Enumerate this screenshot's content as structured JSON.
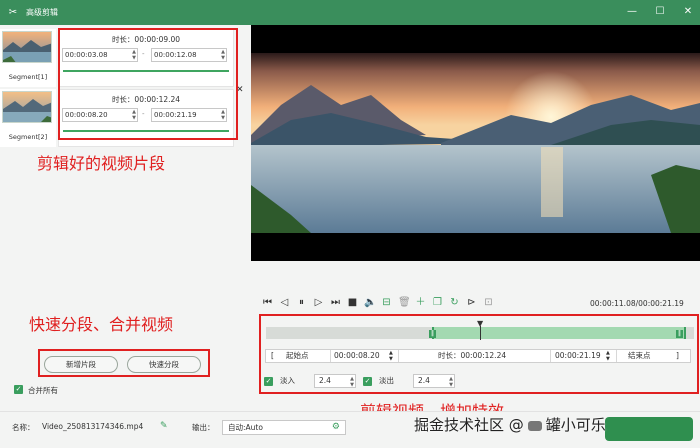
{
  "window": {
    "title": "高级剪辑",
    "minimize_icon": "minimize-icon",
    "maximize_icon": "maximize-icon",
    "close_icon": "close-icon"
  },
  "segments": [
    {
      "label": "Segment[1]",
      "duration": "时长：00:00:09.00",
      "start": "00:00:03.08",
      "end": "00:00:12.08"
    },
    {
      "label": "Segment[2]",
      "duration": "时长：00:00:12.24",
      "start": "00:00:08.20",
      "end": "00:00:21.19"
    }
  ],
  "segment_dash": "-",
  "left_actions": {
    "add_segment": "新增片段",
    "quick_split": "快速分段",
    "merge_all": "合并所有",
    "merge_all_checked": true
  },
  "annotations": {
    "clips": "剪辑好的视频片段",
    "split_merge": "快速分段、合并视频",
    "edit_effects": "剪辑视频、增加特效"
  },
  "player": {
    "current": "00:00:11.08",
    "total": "00:00:21.19",
    "separator": "/"
  },
  "trim": {
    "start_label": "起始点",
    "start_value": "00:00:08.20",
    "duration_label": "时长：00:00:12.24",
    "end_value": "00:00:21.19",
    "end_label": "结束点",
    "left_bracket": "[",
    "right_bracket": "]",
    "playhead_fraction": 0.5
  },
  "effects": {
    "fade_in_label": "淡入",
    "fade_in_value": "2.4",
    "fade_in_checked": true,
    "fade_out_label": "淡出",
    "fade_out_value": "2.4",
    "fade_out_checked": true
  },
  "bottom": {
    "name_label": "名称：",
    "file_name": "Video_250813174346.mp4",
    "output_label": "输出：",
    "output_value": "自动:Auto"
  },
  "watermark": {
    "left": "掘金技术社区",
    "at": "@",
    "right": "罐小可乐"
  },
  "colors": {
    "accent": "#3a8e5c",
    "annotation": "#e02020"
  }
}
